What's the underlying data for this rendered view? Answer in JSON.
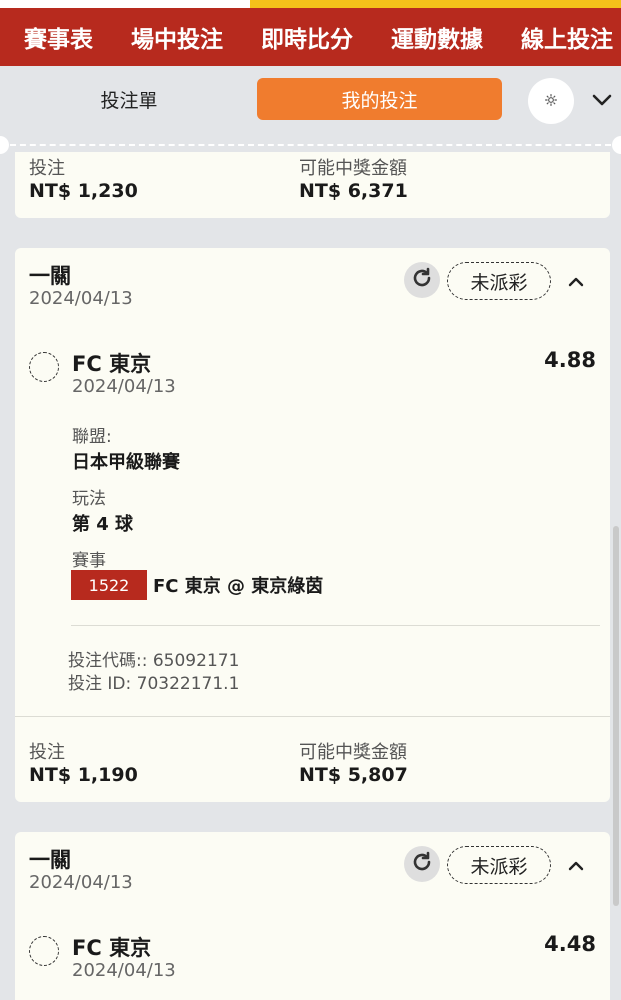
{
  "nav": {
    "tabs": [
      "賽事表",
      "場中投注",
      "即時比分",
      "運動數據",
      "線上投注"
    ]
  },
  "segment": {
    "left_label": "投注單",
    "right_label": "我的投注"
  },
  "card0": {
    "stake_label": "投注",
    "stake_value": "NT$ 1,230",
    "payout_label": "可能中獎金額",
    "payout_value": "NT$ 6,371"
  },
  "card1": {
    "title": "一關",
    "date": "2024/04/13",
    "status": "未派彩",
    "selection": {
      "team": "FC 東京",
      "odds": "4.88",
      "date": "2024/04/13",
      "league_label": "聯盟:",
      "league_value": "日本甲級聯賽",
      "market_label": "玩法",
      "market_value": "第 4 球",
      "event_label": "賽事",
      "event_code": "1522",
      "event_name": "FC 東京 @ 東京綠茵"
    },
    "bet_code": "投注代碼:: 65092171",
    "bet_id": "投注 ID: 70322171.1",
    "stake_label": "投注",
    "stake_value": "NT$ 1,190",
    "payout_label": "可能中獎金額",
    "payout_value": "NT$ 5,807"
  },
  "card2": {
    "title": "一關",
    "date": "2024/04/13",
    "status": "未派彩",
    "selection": {
      "team": "FC 東京",
      "odds": "4.48",
      "date": "2024/04/13"
    }
  },
  "colors": {
    "brand_red": "#b72a1e",
    "accent_orange": "#f07c2e",
    "card_bg": "#fcfcf4",
    "page_bg": "#e3e5e8",
    "gold": "#f4c21a"
  }
}
